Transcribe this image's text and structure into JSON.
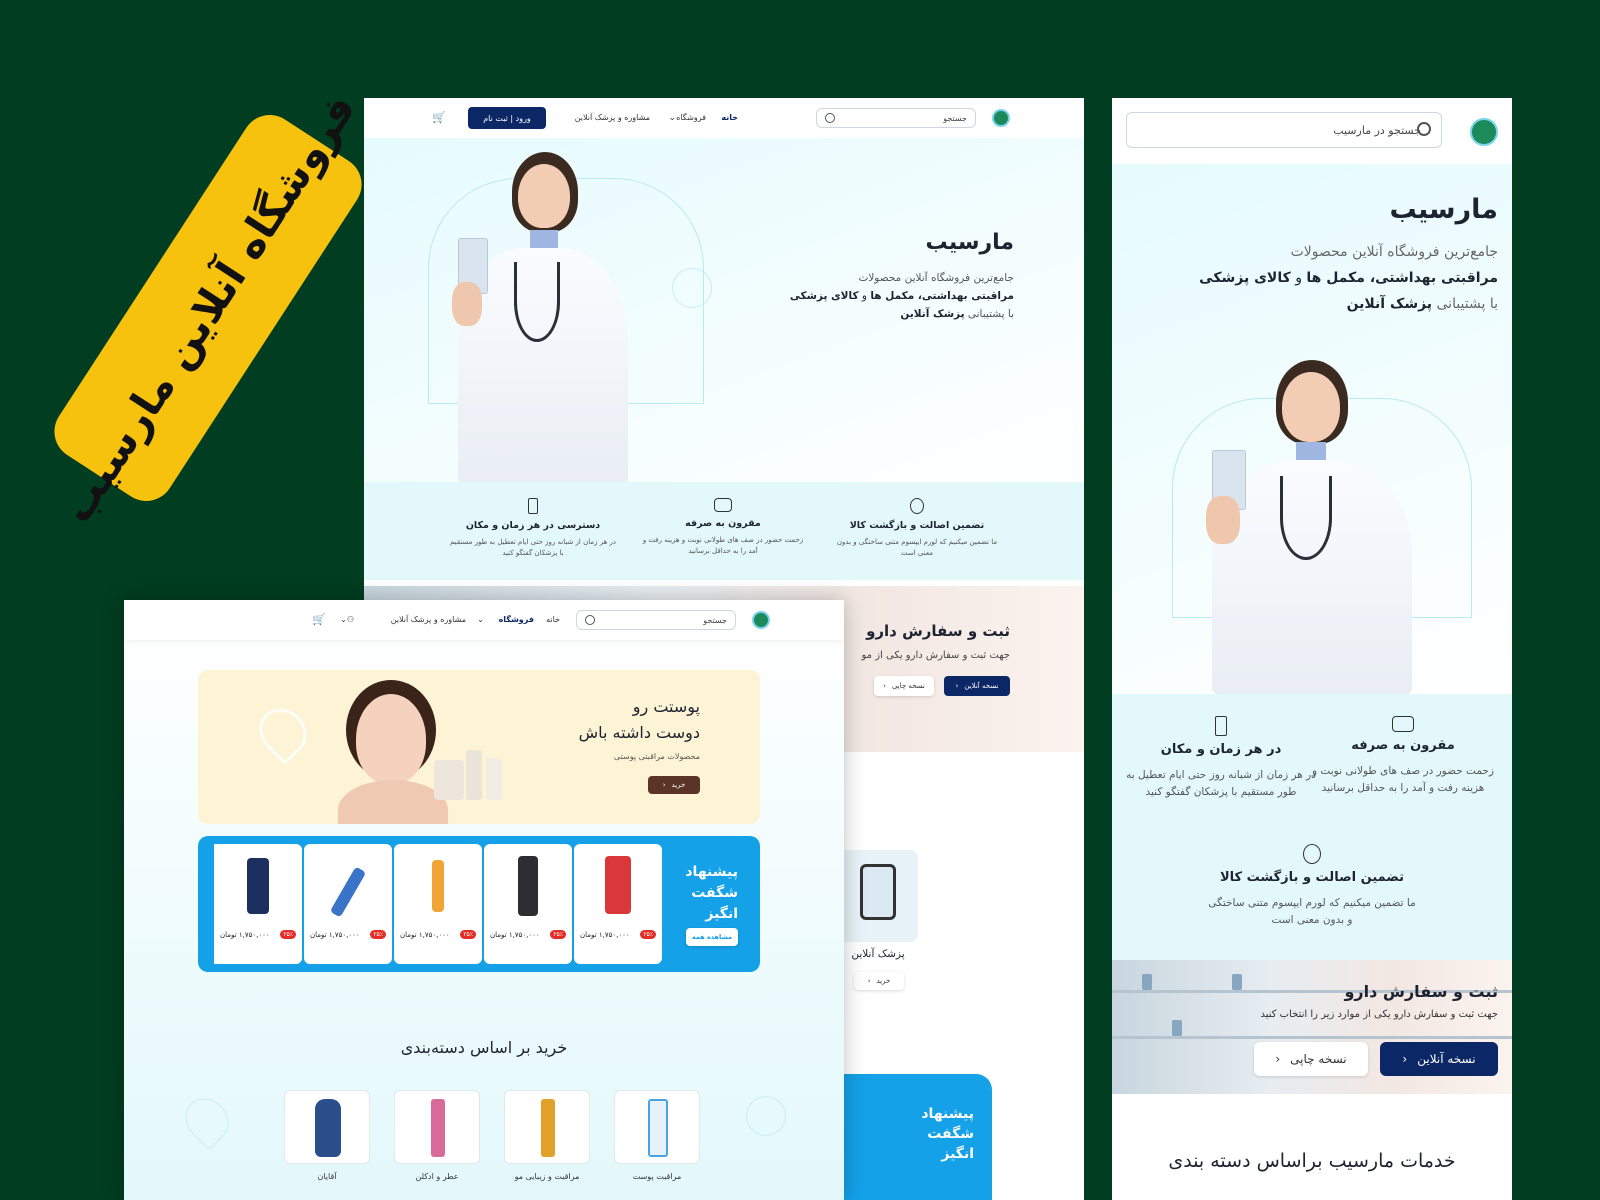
{
  "banner": {
    "text": "فروشگاه آنلاین مارسیب"
  },
  "desktop": {
    "nav": {
      "search_placeholder": "جستجو",
      "home": "خانه",
      "shop": "فروشگاه",
      "consult": "مشاوره و پزشک آنلاین",
      "login": "ورود | ثبت نام"
    },
    "hero": {
      "title": "مارسیب",
      "line1": "جامع‌ترین فروشگاه آنلاین محصولات",
      "line2_a": "مراقبتی بهداشتی، مکمل ها",
      "line2_b": " و ",
      "line2_c": "کالای پزشکی",
      "line3_a": "با پشتیبانی ",
      "line3_b": "پزشک آنلاین"
    },
    "features": [
      {
        "title": "تضمین اصالت و بازگشت کالا",
        "text": "ما تضمین میکنیم که لورم ایپسوم متنی ساختگی و بدون معنی است",
        "icon": "badge-icon"
      },
      {
        "title": "مقرون به صرفه",
        "text": "زحمت حضور در صف های طولانی نوبت و هزینه رفت و آمد را به حداقل برسانید",
        "icon": "wallet-icon"
      },
      {
        "title": "دسترسی در هر زمان و مکان",
        "text": "در هر زمان از شبانه روز حتی ایام تعطیل به طور مستقیم با پزشکان گفتگو کنید",
        "icon": "hourglass-icon"
      }
    ],
    "order": {
      "title": "ثبت و سفارش دارو",
      "text": "جهت ثبت و سفارش دارو یکی از مو",
      "online_btn": "نسخه آنلاین",
      "print_btn": "نسخه چاپی"
    },
    "doctor_card": {
      "title": "پزشک آنلاین",
      "btn": "خرید"
    },
    "promo_partial": {
      "title": "پیشنهاد شگفت انگیز"
    }
  },
  "mobile": {
    "search_placeholder": "جستجو در مارسیب",
    "hero": {
      "title": "مارسیب",
      "line1": "جامع‌ترین فروشگاه آنلاین محصولات",
      "line2_a": "مراقبتی بهداشتی، مکمل ها",
      "line2_b": " و ",
      "line2_c": "کالای پزشکی",
      "line3_a": "با پشتیبانی ",
      "line3_b": "پزشک آنلاین"
    },
    "features": [
      {
        "title": "مقرون به صرفه",
        "text": "زحمت حضور در صف های طولانی نوبت و هزینه رفت و آمد را به حداقل برسانید",
        "icon": "wallet-icon"
      },
      {
        "title": "در هر زمان و مکان",
        "text": "در هر زمان از شبانه روز حتی ایام تعطیل به طور مستقیم با پزشکان گفتگو کنید",
        "icon": "hourglass-icon"
      },
      {
        "title": "تضمین اصالت و بازگشت کالا",
        "text": "ما تضمین میکنیم که لورم ایپسوم متنی ساختگی و بدون معنی است",
        "icon": "badge-icon"
      }
    ],
    "order": {
      "title": "ثبت و سفارش دارو",
      "text": "جهت ثبت و سفارش دارو یکی از موارد زیر را انتخاب کنید",
      "online_btn": "نسخه آنلاین",
      "print_btn": "نسخه چاپی"
    },
    "services_title": "خدمات مارسیب براساس دسته بندی"
  },
  "shop": {
    "nav": {
      "search_placeholder": "جستجو",
      "home": "خانه",
      "shop": "فروشگاه",
      "consult": "مشاوره و پزشک آنلاین"
    },
    "skin_banner": {
      "title1": "پوستت رو",
      "title2": "دوست داشته باش",
      "subtitle": "محصولات مراقبتی پوستی",
      "btn": "خرید"
    },
    "offer": {
      "title": "پیشنهاد شگفت انگیز",
      "btn": "مشاهده همه",
      "products": [
        {
          "price": "۱,۷۵۰,۰۰۰",
          "currency": "تومان",
          "discount": "۲۵٪",
          "color": "#d9373a"
        },
        {
          "price": "۱,۷۵۰,۰۰۰",
          "currency": "تومان",
          "discount": "۲۵٪",
          "color": "#2d2d33"
        },
        {
          "price": "۱,۷۵۰,۰۰۰",
          "currency": "تومان",
          "discount": "۲۵٪",
          "color": "#f0a534"
        },
        {
          "price": "۱,۷۵۰,۰۰۰",
          "currency": "تومان",
          "discount": "۲۵٪",
          "color": "#3a74c9"
        },
        {
          "price": "۱,۷۵۰,۰۰۰",
          "currency": "تومان",
          "discount": "۲۵٪",
          "color": "#1d2f5e"
        }
      ]
    },
    "categories_title": "خرید بر اساس دسته‌بندی",
    "categories": [
      {
        "label": "مراقبت پوست",
        "color": "#4aa3e0"
      },
      {
        "label": "مراقبت و زیبایی مو",
        "color": "#e0a02a"
      },
      {
        "label": "عطر و ادکلن",
        "color": "#d86a9a"
      },
      {
        "label": "آقایان",
        "color": "#2b4f8a"
      }
    ]
  }
}
